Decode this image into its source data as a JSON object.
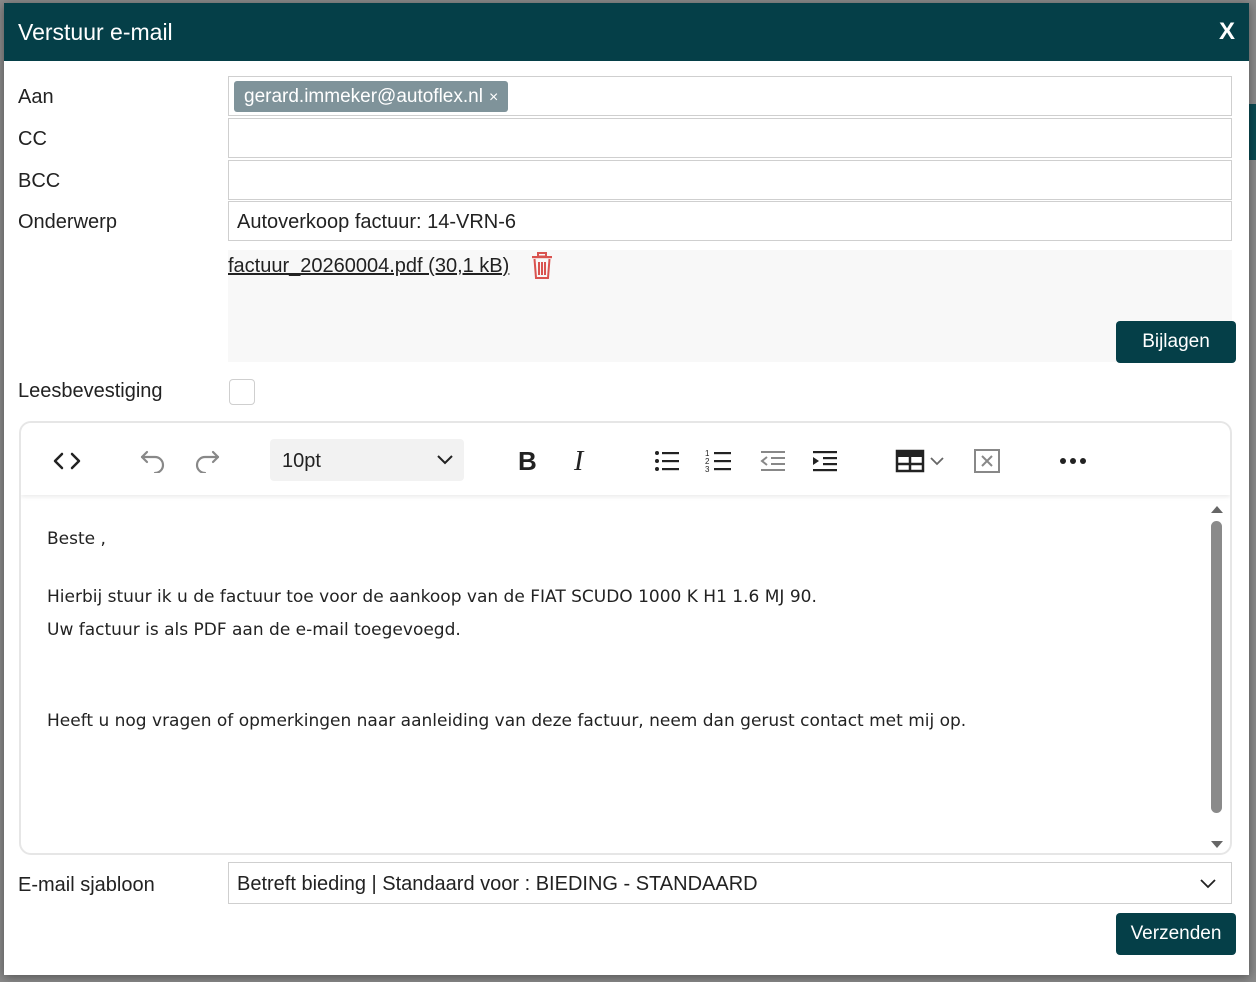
{
  "dialog": {
    "title": "Verstuur e-mail",
    "close_label": "X"
  },
  "form": {
    "to_label": "Aan",
    "to_recipients": [
      {
        "email": "gerard.immeker@autoflex.nl",
        "remove_label": "×"
      }
    ],
    "cc_label": "CC",
    "cc_value": "",
    "bcc_label": "BCC",
    "bcc_value": "",
    "subject_label": "Onderwerp",
    "subject_value": "Autoverkoop factuur: 14-VRN-6",
    "attachment": {
      "text": "factuur_20260004.pdf (30,1 kB)"
    },
    "attachments_button": "Bijlagen",
    "read_receipt_label": "Leesbevestiging",
    "read_receipt_checked": false
  },
  "editor": {
    "toolbar": {
      "icons": [
        "source-code-icon",
        "undo-icon",
        "redo-icon",
        "font-size-select",
        "bold-icon",
        "italic-icon",
        "bullet-list-icon",
        "numbered-list-icon",
        "outdent-icon",
        "indent-icon",
        "table-icon",
        "remove-format-icon",
        "more-icon"
      ],
      "font_size": "10pt"
    },
    "body": {
      "line1": "Beste ,",
      "line2": "Hierbij stuur ik u de factuur toe voor de aankoop van de FIAT SCUDO 1000 K H1 1.6 MJ 90.",
      "line3": "Uw factuur is als PDF aan de e-mail toegevoegd.",
      "line4": "Heeft u nog vragen of opmerkingen naar aanleiding van deze factuur, neem dan gerust contact met mij op."
    }
  },
  "template": {
    "label": "E-mail sjabloon",
    "selected": "Betreft bieding | Standaard voor : BIEDING - STANDAARD"
  },
  "send_button": "Verzenden",
  "colors": {
    "primary": "#053f48",
    "chip": "#7f939a",
    "trash": "#d9534f"
  }
}
